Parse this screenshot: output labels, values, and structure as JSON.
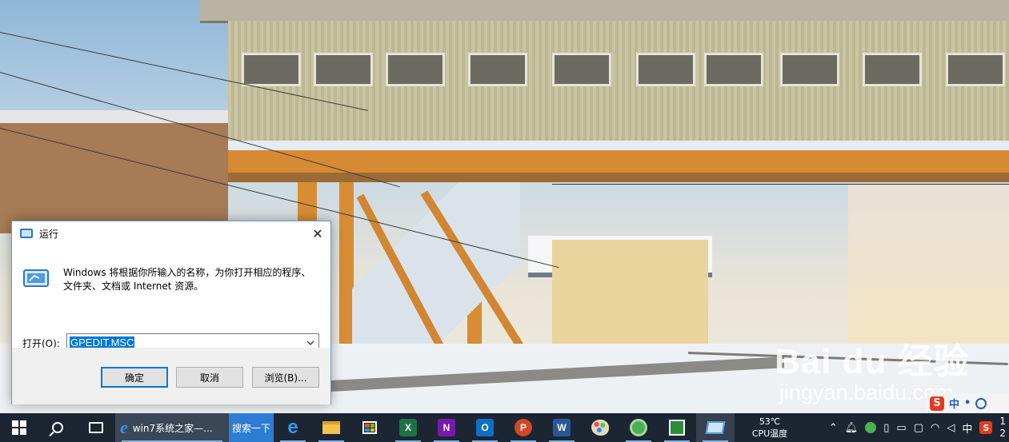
{
  "watermark": {
    "logo_text": "Bai du 经验",
    "url": "jingyan.baidu.com"
  },
  "ime": {
    "logo_letter": "S",
    "mode": "中",
    "punct": "•",
    "icon": "smiley-icon"
  },
  "run_dialog": {
    "title": "运行",
    "description": "Windows 将根据你所输入的名称，为你打开相应的程序、文件夹、文档或 Internet 资源。",
    "open_label": "打开(O):",
    "input_value": "GPEDIT.MSC",
    "buttons": {
      "ok": "确定",
      "cancel": "取消",
      "browse": "浏览(B)..."
    },
    "close_glyph": "✕",
    "accent": "#0078d7"
  },
  "taskbar": {
    "ie_window_title": "win7系统之家—...",
    "search_label": "搜索一下",
    "apps": [
      {
        "name": "edge",
        "icon": "edge-icon"
      },
      {
        "name": "explorer",
        "icon": "folder-icon"
      },
      {
        "name": "store",
        "icon": "store-icon"
      },
      {
        "name": "excel",
        "icon": "excel-icon",
        "letter": "X"
      },
      {
        "name": "onenote",
        "icon": "onenote-icon",
        "letter": "N"
      },
      {
        "name": "outlook",
        "icon": "outlook-icon",
        "letter": "O"
      },
      {
        "name": "powerpoint",
        "icon": "powerpoint-icon",
        "letter": "P"
      },
      {
        "name": "word",
        "icon": "word-icon",
        "letter": "W"
      },
      {
        "name": "paint",
        "icon": "paint-icon"
      },
      {
        "name": "360",
        "icon": "browser360-icon"
      },
      {
        "name": "photos",
        "icon": "photos-icon"
      },
      {
        "name": "run",
        "icon": "run-icon"
      }
    ],
    "temperature": "53℃",
    "temperature_label": "CPU温度",
    "tray_ime": "中",
    "tray_ime_logo": "S",
    "clock_partial": "1\n2",
    "color": "#1c2633"
  }
}
